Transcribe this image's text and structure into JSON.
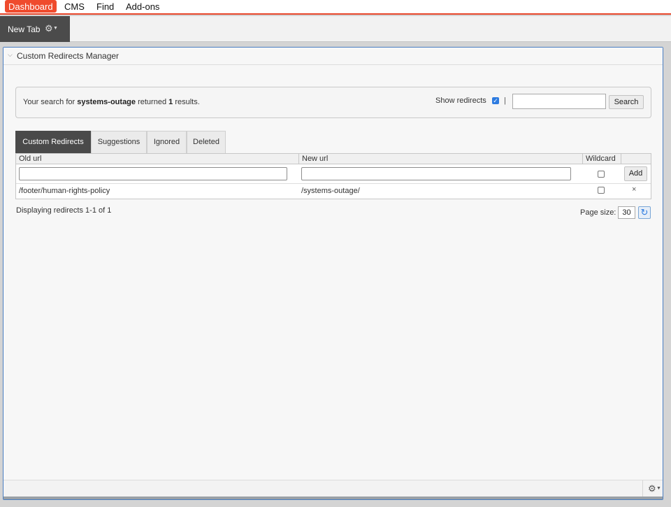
{
  "topnav": {
    "items": [
      "Dashboard",
      "CMS",
      "Find",
      "Add-ons"
    ],
    "active": "Dashboard",
    "accent_color": "#ef4b2d"
  },
  "tabbar": {
    "tab_label": "New Tab",
    "gear_icon": "gear-icon"
  },
  "gadget": {
    "title": "Custom Redirects Manager",
    "collapse_icon": "chevron-down-icon"
  },
  "search": {
    "message_prefix": "Your search for",
    "term": "systems-outage",
    "message_mid": "returned",
    "count": "1",
    "message_suffix": "results.",
    "show_redirects_label": "Show redirects",
    "show_redirects_checked": true,
    "separator": "|",
    "input_value": "",
    "button_label": "Search"
  },
  "tabs": [
    {
      "label": "Custom Redirects",
      "active": true
    },
    {
      "label": "Suggestions",
      "active": false
    },
    {
      "label": "Ignored",
      "active": false
    },
    {
      "label": "Deleted",
      "active": false
    }
  ],
  "grid": {
    "columns": [
      "Old url",
      "New url",
      "Wildcard",
      ""
    ],
    "new_row": {
      "old_url": "",
      "new_url": "",
      "wildcard": false,
      "add_label": "Add"
    },
    "rows": [
      {
        "old_url": "/footer/human-rights-policy",
        "new_url": "/systems-outage/",
        "wildcard": false,
        "delete_glyph": "×"
      }
    ]
  },
  "pager": {
    "status": "Displaying redirects 1-1 of 1",
    "page_size_label": "Page size:",
    "page_size": "30",
    "refresh_icon": "refresh-icon"
  },
  "footer": {
    "gear_icon": "gear-icon"
  }
}
